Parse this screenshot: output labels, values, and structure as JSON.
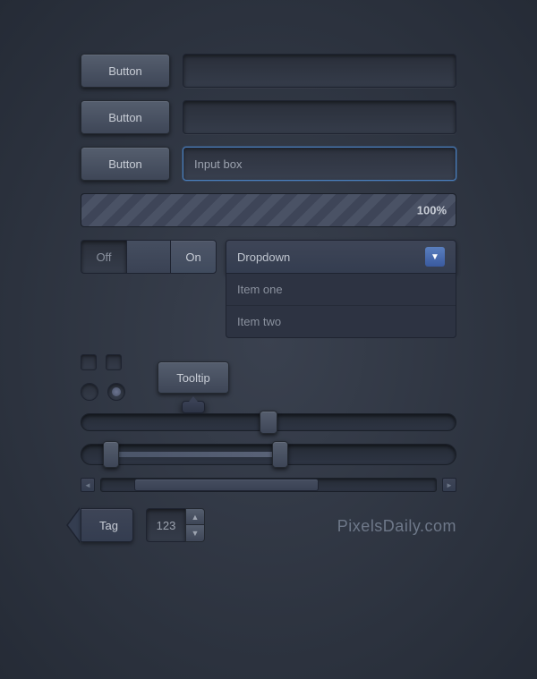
{
  "buttons": {
    "btn1_label": "Button",
    "btn2_label": "Button",
    "btn3_label": "Button"
  },
  "inputs": {
    "input1_placeholder": "",
    "input2_placeholder": "",
    "input3_placeholder": "Input box",
    "input3_value": "Input box"
  },
  "progress": {
    "label": "100%"
  },
  "toggle": {
    "off_label": "Off",
    "on_label": "On"
  },
  "dropdown": {
    "label": "Dropdown",
    "item1": "Item one",
    "item2": "Item two"
  },
  "tooltip": {
    "btn_label": "Tooltip"
  },
  "scrollbar": {
    "left_arrow": "◄",
    "right_arrow": "►"
  },
  "tag": {
    "label": "Tag"
  },
  "number": {
    "value": "123",
    "up": "▲",
    "down": "▼"
  },
  "brand": {
    "name": "PixelsDaily",
    "suffix": ".com"
  }
}
